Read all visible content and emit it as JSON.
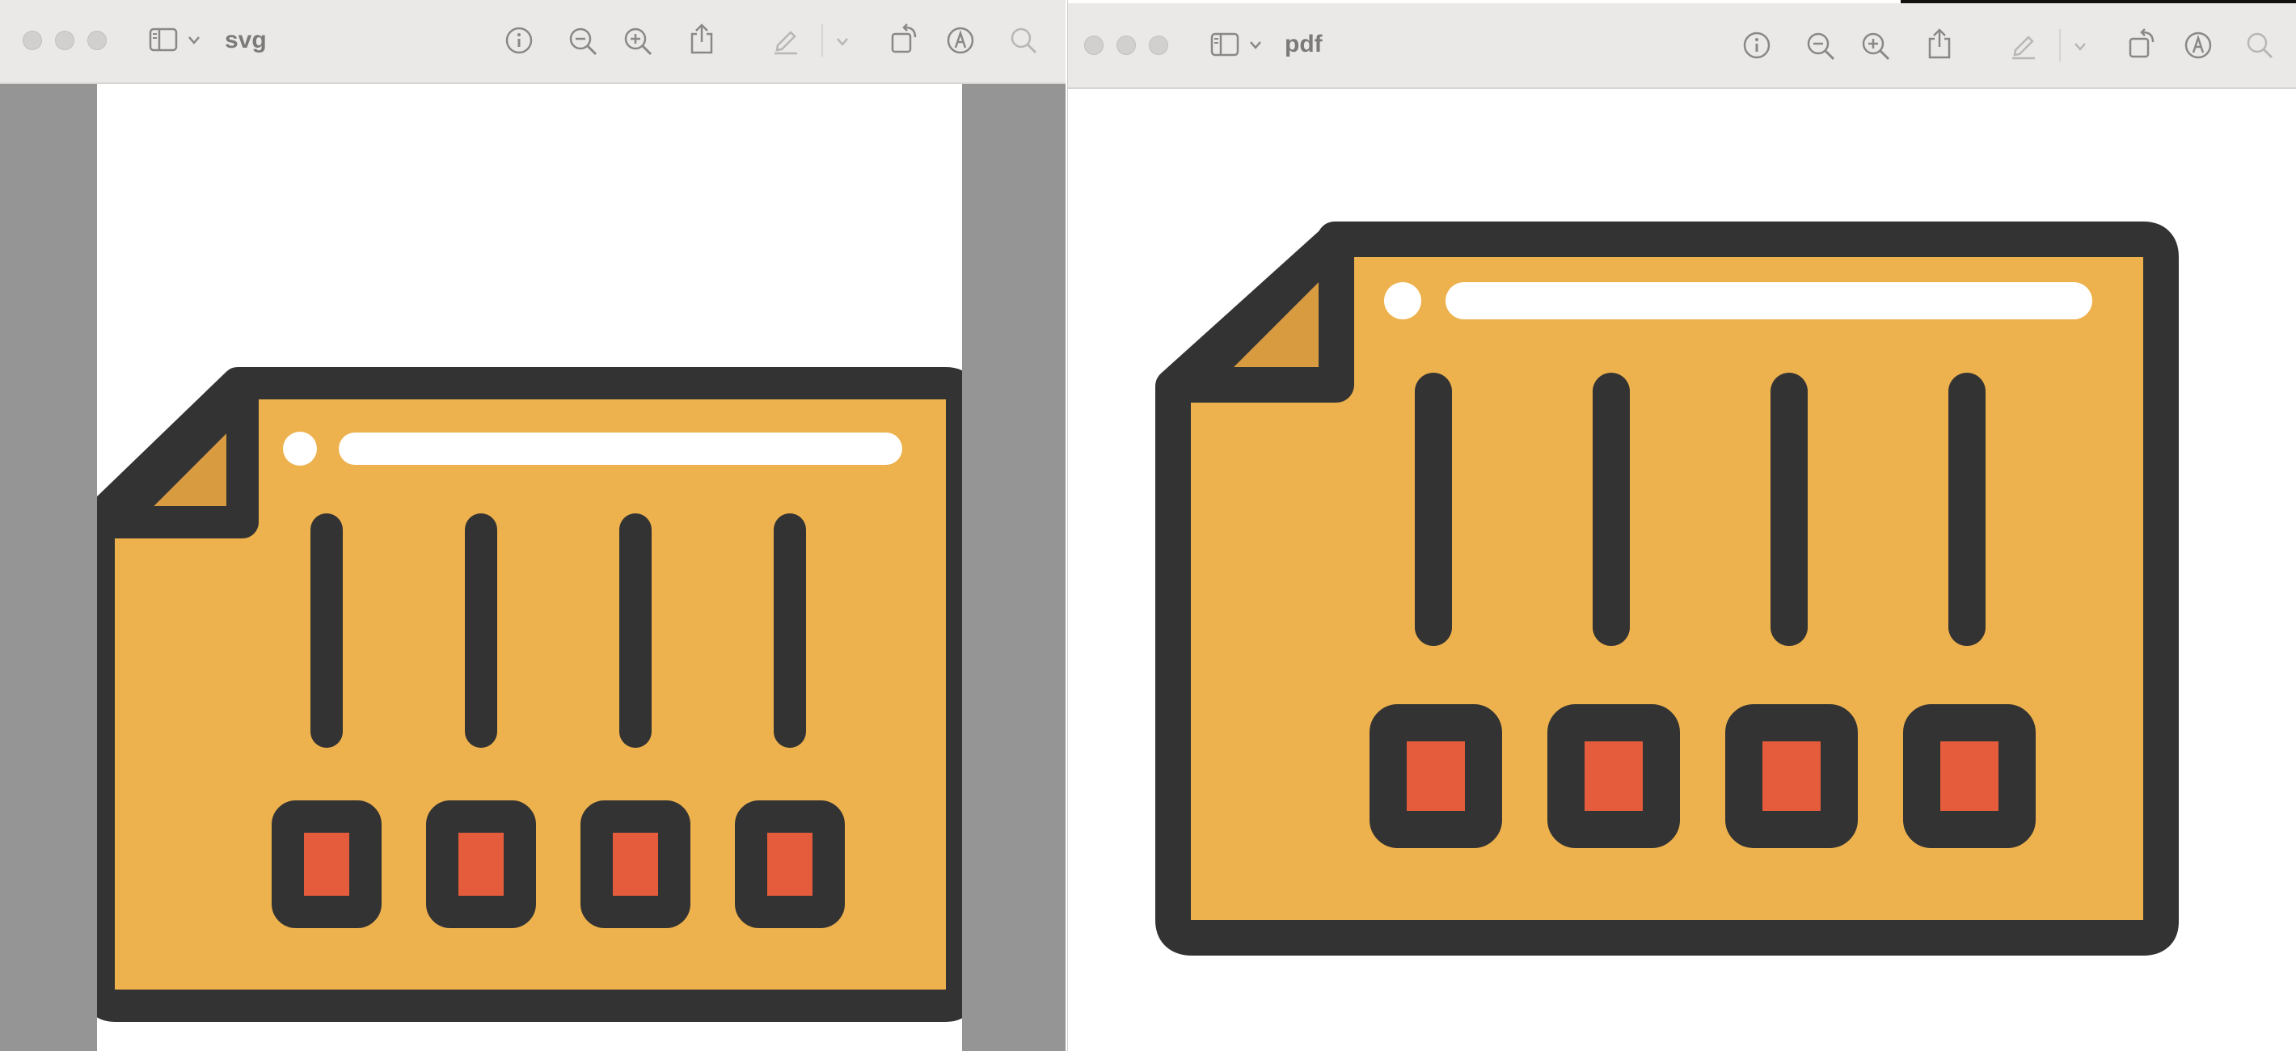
{
  "windows": [
    {
      "id": "left",
      "title": "svg",
      "toolbar_icons": [
        "sidebar-icon",
        "chevron-down-icon",
        "info-icon",
        "zoom-out-icon",
        "zoom-in-icon",
        "share-icon",
        "highlight-pen-icon",
        "chevron-down-icon",
        "rotate-icon",
        "markup-icon",
        "search-icon"
      ]
    },
    {
      "id": "right",
      "title": "pdf",
      "toolbar_icons": [
        "sidebar-icon",
        "chevron-down-icon",
        "info-icon",
        "zoom-out-icon",
        "zoom-in-icon",
        "share-icon",
        "highlight-pen-icon",
        "chevron-down-icon",
        "rotate-icon",
        "markup-icon",
        "search-icon"
      ]
    }
  ],
  "artwork": {
    "subject": "memory-card-icon",
    "sliders": 4,
    "colors": {
      "outline": "#333333",
      "card_fill": "#edb24e",
      "corner_fold": "#d99b40",
      "button_fill": "#e45c3b",
      "highlight": "#ffffff",
      "left_pane_background": "#959595",
      "toolbar_background": "#ebe9e7"
    }
  }
}
